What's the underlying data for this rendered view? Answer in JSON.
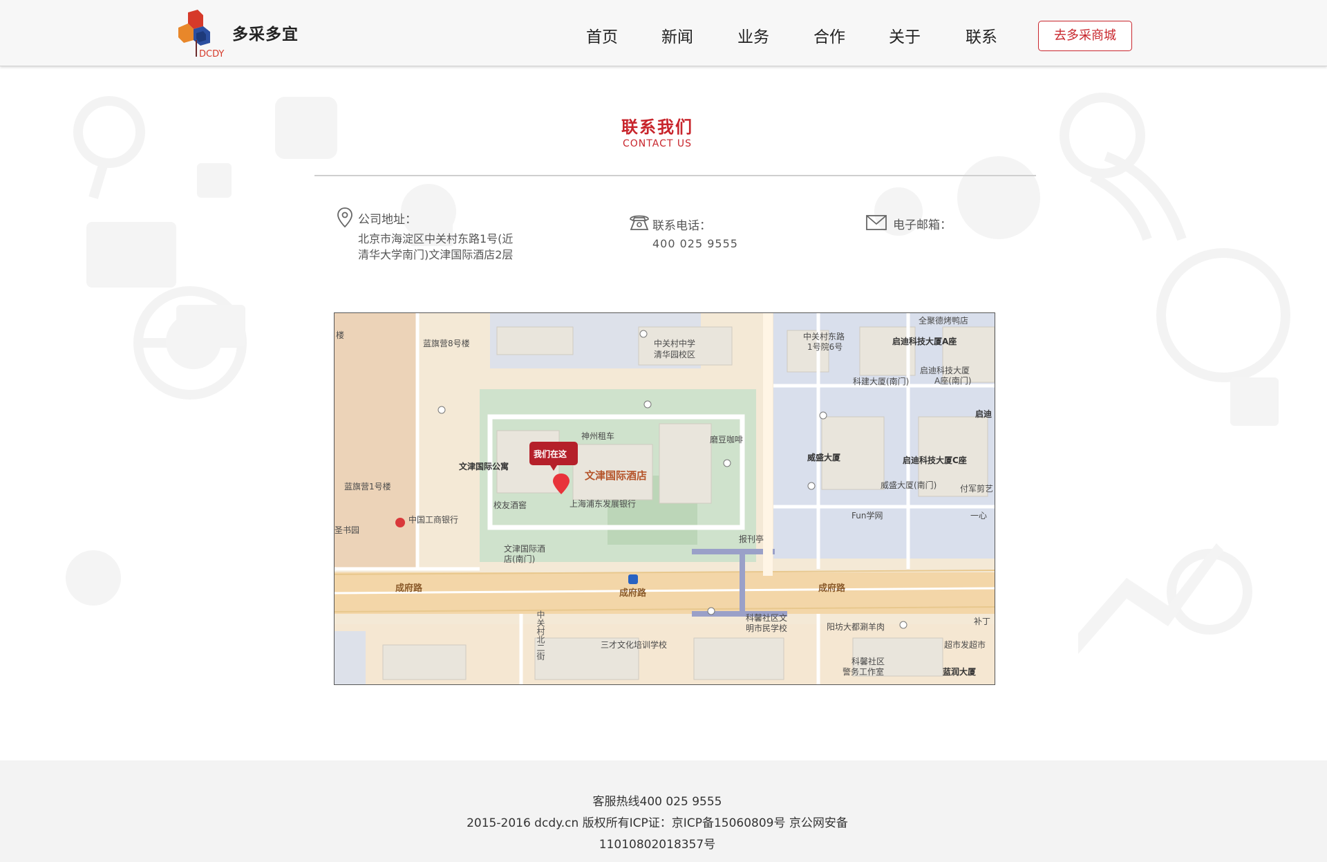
{
  "header": {
    "brand": "多采多宜",
    "logo_text": "DCDY",
    "nav": [
      {
        "label": "首页"
      },
      {
        "label": "新闻"
      },
      {
        "label": "业务"
      },
      {
        "label": "合作"
      },
      {
        "label": "关于"
      },
      {
        "label": "联系"
      }
    ],
    "mall_button": "去多采商城"
  },
  "contact": {
    "title_cn": "联系我们",
    "title_en": "CONTACT US",
    "address_label": "公司地址：",
    "address_lines": [
      "北京市海淀区中关村东路1号(近",
      "清华大学南门)文津国际酒店2层"
    ],
    "phone_label": "联系电话：",
    "phone_value": "400 025 9555",
    "email_label": "电子邮箱：",
    "icons": {
      "address": "location-pin-icon",
      "phone": "telephone-icon",
      "email": "envelope-icon"
    }
  },
  "map": {
    "marker_bubble": "我们在这",
    "main_place": "文津国际酒店",
    "roads": [
      "成府路",
      "成府路",
      "成府路",
      "中关村北二街"
    ],
    "labels": [
      "蓝旗营8号楼",
      "中关村中学",
      "清华园校区",
      "中关村东路",
      "1号院6号",
      "全聚德烤鸭店",
      "启迪科技大厦A座",
      "科建大厦(南门)",
      "启迪科技大厦",
      "A座(南门)",
      "启迪",
      "神州租车",
      "磨豆咖啡",
      "文津国际公寓",
      "威盛大厦",
      "启迪科技大厦C座",
      "蓝旗营1号楼",
      "校友酒窖",
      "上海浦东发展银行",
      "威盛大厦(南门)",
      "付军剪艺",
      "中国工商银行",
      "Fun学网",
      "一心",
      "圣书园",
      "文津国际酒",
      "店(南门)",
      "报刊亭",
      "三才文化培训学校",
      "科馨社区文",
      "明市民学校",
      "阳坊大都涮羊肉",
      "超市发超市",
      "科馨社区",
      "警务工作室",
      "蓝润大厦",
      "补丁",
      "楼"
    ],
    "colors": {
      "campus_green": "#cfe2cc",
      "block_blue": "#d9dfec",
      "road": "#f5d9a6",
      "marker": "#c8252c"
    }
  },
  "footer": {
    "hotline": "客服热线400 025 9555",
    "copyright": "2015-2016 dcdy.cn 版权所有ICP证：京ICP备15060809号 京公网安备",
    "beian": "11010802018357号"
  },
  "colors": {
    "accent": "#c8252c",
    "header_bg": "#f7f7f7",
    "footer_bg": "#f3f3f3"
  }
}
